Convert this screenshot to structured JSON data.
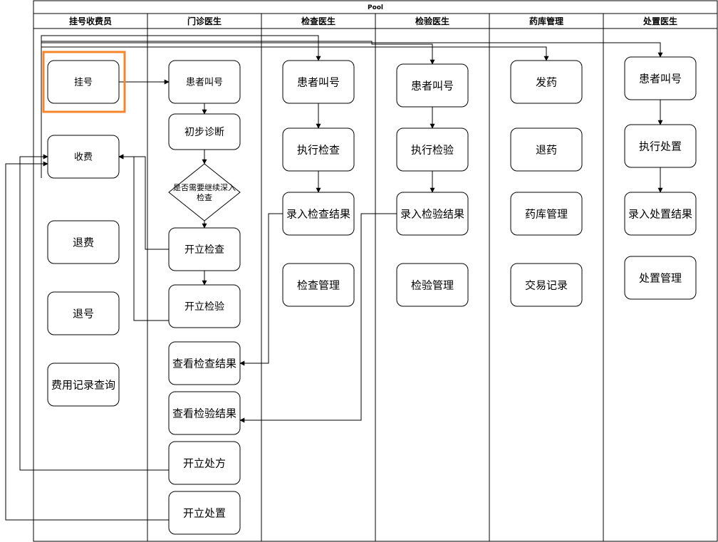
{
  "pool_title": "Pool",
  "lanes": [
    {
      "id": "cashier",
      "title": "挂号收费员"
    },
    {
      "id": "doctor",
      "title": "门诊医生"
    },
    {
      "id": "exam",
      "title": "检查医生"
    },
    {
      "id": "lab",
      "title": "检验医生"
    },
    {
      "id": "pharmacy",
      "title": "药库管理"
    },
    {
      "id": "treat",
      "title": "处置医生"
    }
  ],
  "nodes": [
    {
      "id": "register",
      "lane": "cashier",
      "label": "挂号",
      "shape": "rect",
      "highlight": true
    },
    {
      "id": "charge",
      "lane": "cashier",
      "label": "收费",
      "shape": "rect"
    },
    {
      "id": "refund",
      "lane": "cashier",
      "label": "退费",
      "shape": "rect"
    },
    {
      "id": "unregister",
      "lane": "cashier",
      "label": "退号",
      "shape": "rect"
    },
    {
      "id": "fee-query",
      "lane": "cashier",
      "label": "费用记录查询",
      "shape": "rect"
    },
    {
      "id": "doc-call",
      "lane": "doctor",
      "label": "患者叫号",
      "shape": "rect"
    },
    {
      "id": "diagnose",
      "lane": "doctor",
      "label": "初步诊断",
      "shape": "rect"
    },
    {
      "id": "decision",
      "lane": "doctor",
      "label_lines": [
        "是否需要继续深入",
        "检查"
      ],
      "shape": "diamond"
    },
    {
      "id": "order-exam",
      "lane": "doctor",
      "label": "开立检查",
      "shape": "rect"
    },
    {
      "id": "order-lab",
      "lane": "doctor",
      "label": "开立检验",
      "shape": "rect"
    },
    {
      "id": "view-exam",
      "lane": "doctor",
      "label": "查看检查结果",
      "shape": "rect"
    },
    {
      "id": "view-lab",
      "lane": "doctor",
      "label": "查看检验结果",
      "shape": "rect"
    },
    {
      "id": "prescribe",
      "lane": "doctor",
      "label": "开立处方",
      "shape": "rect"
    },
    {
      "id": "order-treat",
      "lane": "doctor",
      "label": "开立处置",
      "shape": "rect"
    },
    {
      "id": "exam-call",
      "lane": "exam",
      "label": "患者叫号",
      "shape": "rect"
    },
    {
      "id": "exam-do",
      "lane": "exam",
      "label": "执行检查",
      "shape": "rect"
    },
    {
      "id": "exam-record",
      "lane": "exam",
      "label": "录入检查结果",
      "shape": "rect"
    },
    {
      "id": "exam-manage",
      "lane": "exam",
      "label": "检查管理",
      "shape": "rect"
    },
    {
      "id": "lab-call",
      "lane": "lab",
      "label": "患者叫号",
      "shape": "rect"
    },
    {
      "id": "lab-do",
      "lane": "lab",
      "label": "执行检验",
      "shape": "rect"
    },
    {
      "id": "lab-record",
      "lane": "lab",
      "label": "录入检验结果",
      "shape": "rect"
    },
    {
      "id": "lab-manage",
      "lane": "lab",
      "label": "检验管理",
      "shape": "rect"
    },
    {
      "id": "dispense",
      "lane": "pharmacy",
      "label": "发药",
      "shape": "rect"
    },
    {
      "id": "return-drug",
      "lane": "pharmacy",
      "label": "退药",
      "shape": "rect"
    },
    {
      "id": "store-manage",
      "lane": "pharmacy",
      "label": "药库管理",
      "shape": "rect"
    },
    {
      "id": "txn-log",
      "lane": "pharmacy",
      "label": "交易记录",
      "shape": "rect"
    },
    {
      "id": "treat-call",
      "lane": "treat",
      "label": "患者叫号",
      "shape": "rect"
    },
    {
      "id": "treat-do",
      "lane": "treat",
      "label": "执行处置",
      "shape": "rect"
    },
    {
      "id": "treat-record",
      "lane": "treat",
      "label": "录入处置结果",
      "shape": "rect"
    },
    {
      "id": "treat-manage",
      "lane": "treat",
      "label": "处置管理",
      "shape": "rect"
    }
  ],
  "edges": [
    {
      "from": "register",
      "to": "doc-call"
    },
    {
      "from": "doc-call",
      "to": "diagnose"
    },
    {
      "from": "diagnose",
      "to": "decision"
    },
    {
      "from": "decision",
      "to": "order-exam"
    },
    {
      "from": "order-exam",
      "to": "order-lab"
    },
    {
      "from": "order-exam",
      "to": "charge"
    },
    {
      "from": "order-lab",
      "to": "charge"
    },
    {
      "from": "prescribe",
      "to": "charge"
    },
    {
      "from": "order-treat",
      "to": "charge"
    },
    {
      "from": "charge",
      "to": "exam-call"
    },
    {
      "from": "charge",
      "to": "lab-call"
    },
    {
      "from": "charge",
      "to": "dispense"
    },
    {
      "from": "charge",
      "to": "treat-call"
    },
    {
      "from": "exam-call",
      "to": "exam-do"
    },
    {
      "from": "exam-do",
      "to": "exam-record"
    },
    {
      "from": "exam-record",
      "to": "view-exam"
    },
    {
      "from": "lab-call",
      "to": "lab-do"
    },
    {
      "from": "lab-do",
      "to": "lab-record"
    },
    {
      "from": "lab-record",
      "to": "view-lab"
    },
    {
      "from": "treat-call",
      "to": "treat-do"
    },
    {
      "from": "treat-do",
      "to": "treat-record"
    }
  ],
  "colors": {
    "highlight": "#F5862A",
    "stroke": "#000000",
    "background": "#FFFFFF"
  }
}
